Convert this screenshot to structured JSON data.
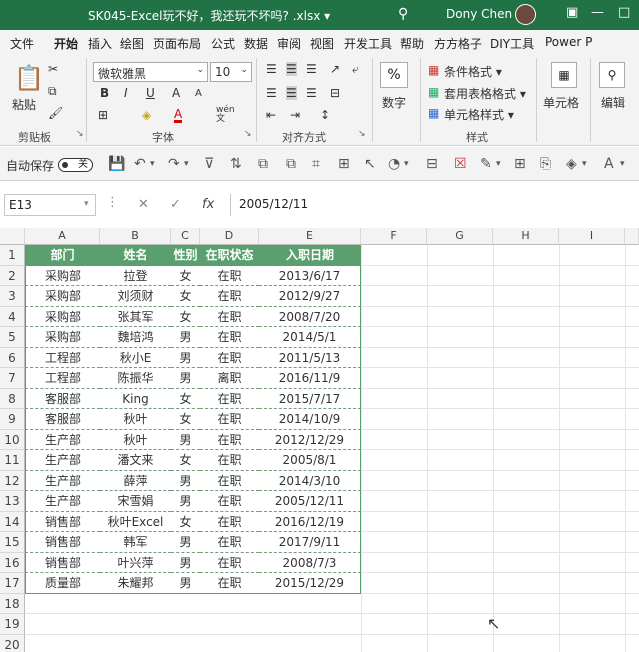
{
  "titlebar": {
    "title": "SK045-Excel玩不好，我还玩不坏吗? .xlsx ▾",
    "user": "Dony Chen"
  },
  "tabs": [
    "文件",
    "开始",
    "插入",
    "绘图",
    "页面布局",
    "公式",
    "数据",
    "审阅",
    "视图",
    "开发工具",
    "帮助",
    "方方格子",
    "DIY工具",
    "Power P"
  ],
  "ribbon": {
    "paste": "粘贴",
    "clipboard": "剪贴板",
    "font_name": "微软雅黑",
    "font_size": "10",
    "font": "字体",
    "align": "对齐方式",
    "number": "数字",
    "cond": "条件格式 ▾",
    "table": "套用表格格式 ▾",
    "cellstyle": "单元格样式 ▾",
    "styles": "样式",
    "cells": "单元格",
    "edit": "编辑",
    "percent": "%",
    "bold": "B",
    "italic": "I",
    "underline": "U",
    "wen": "wén\n文"
  },
  "qat": {
    "autosave": "自动保存",
    "toggle": "关"
  },
  "formula_bar": {
    "name": "E13",
    "fx": "fx",
    "value": "2005/12/11"
  },
  "columns": [
    "A",
    "B",
    "C",
    "D",
    "E",
    "F",
    "G",
    "H",
    "I"
  ],
  "headers": [
    "部门",
    "姓名",
    "性别",
    "在职状态",
    "入职日期"
  ],
  "rows": [
    [
      "采购部",
      "拉登",
      "女",
      "在职",
      "2013/6/17"
    ],
    [
      "采购部",
      "刘须财",
      "女",
      "在职",
      "2012/9/27"
    ],
    [
      "采购部",
      "张其军",
      "女",
      "在职",
      "2008/7/20"
    ],
    [
      "采购部",
      "魏培鸿",
      "男",
      "在职",
      "2014/5/1"
    ],
    [
      "工程部",
      "秋小E",
      "男",
      "在职",
      "2011/5/13"
    ],
    [
      "工程部",
      "陈振华",
      "男",
      "离职",
      "2016/11/9"
    ],
    [
      "客服部",
      "King",
      "女",
      "在职",
      "2015/7/17"
    ],
    [
      "客服部",
      "秋叶",
      "女",
      "在职",
      "2014/10/9"
    ],
    [
      "生产部",
      "秋叶",
      "男",
      "在职",
      "2012/12/29"
    ],
    [
      "生产部",
      "潘文来",
      "女",
      "在职",
      "2005/8/1"
    ],
    [
      "生产部",
      "薛萍",
      "男",
      "在职",
      "2014/3/10"
    ],
    [
      "生产部",
      "宋雪娟",
      "男",
      "在职",
      "2005/12/11"
    ],
    [
      "销售部",
      "秋叶Excel",
      "女",
      "在职",
      "2016/12/19"
    ],
    [
      "销售部",
      "韩军",
      "男",
      "在职",
      "2017/9/11"
    ],
    [
      "销售部",
      "叶兴萍",
      "男",
      "在职",
      "2008/7/3"
    ],
    [
      "质量部",
      "朱耀邦",
      "男",
      "在职",
      "2015/12/29"
    ]
  ],
  "row_numbers": [
    "1",
    "2",
    "3",
    "4",
    "5",
    "6",
    "7",
    "8",
    "9",
    "10",
    "11",
    "12",
    "13",
    "14",
    "15",
    "16",
    "17",
    "18",
    "19",
    "20"
  ]
}
